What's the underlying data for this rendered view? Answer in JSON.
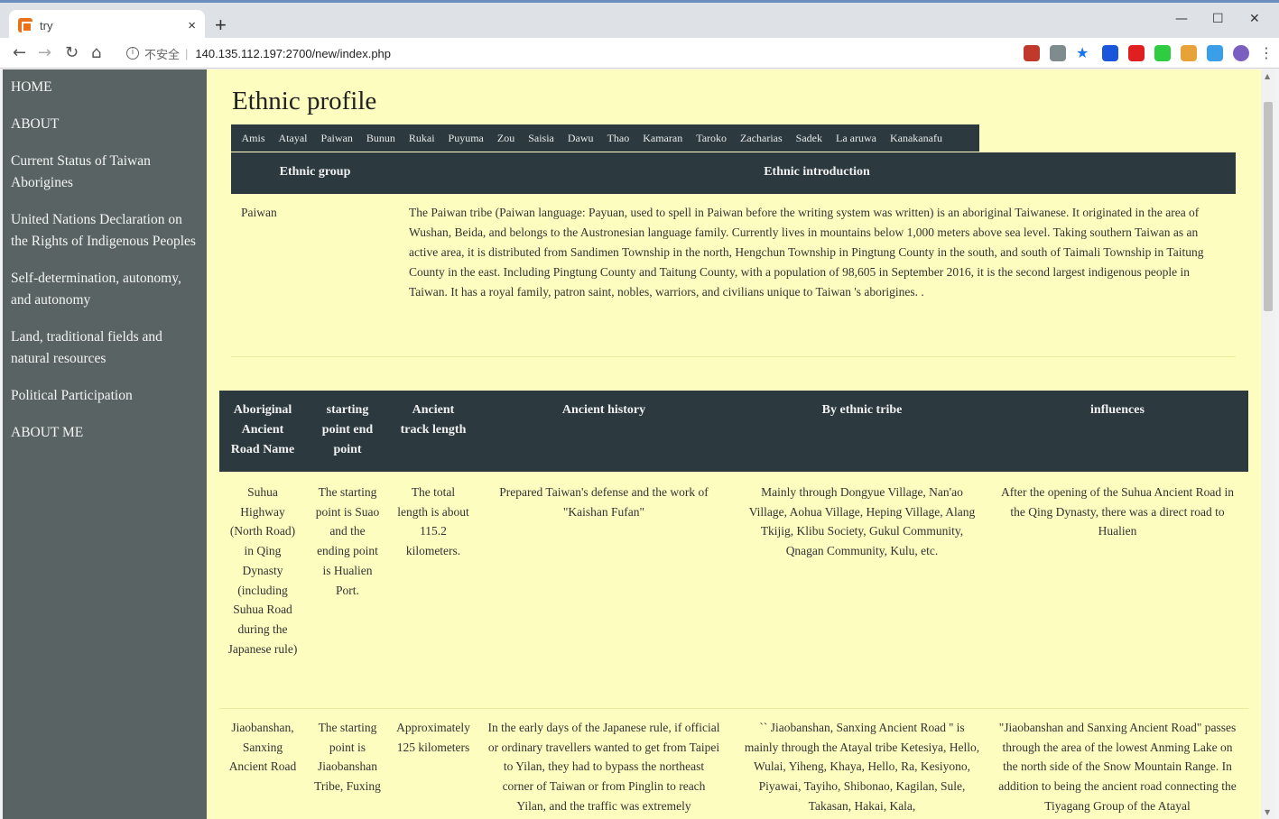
{
  "browser": {
    "tab_title": "try",
    "tab_close": "×",
    "new_tab": "+",
    "security_label": "不安全",
    "url": "140.135.112.197:2700/new/index.php",
    "window_controls": [
      "—",
      "☐",
      "✕"
    ],
    "nav": {
      "back": "←",
      "forward": "→",
      "reload": "↻",
      "home": "⌂"
    },
    "extensions": [
      {
        "name": "ext-icon-1",
        "color": "#c0392b"
      },
      {
        "name": "ext-icon-2",
        "color": "#7f8c8d"
      },
      {
        "name": "bookmark-star-icon",
        "color": "#1a73e8"
      },
      {
        "name": "ext-icon-3",
        "color": "#1a56db"
      },
      {
        "name": "ext-icon-4",
        "color": "#e02020"
      },
      {
        "name": "ext-icon-5",
        "color": "#2ecc40"
      },
      {
        "name": "ext-icon-6",
        "color": "#e8a23a"
      },
      {
        "name": "ext-icon-7",
        "color": "#3b9ee8"
      },
      {
        "name": "profile-avatar-icon",
        "color": "#7a5fc0"
      },
      {
        "name": "menu-icon",
        "color": "#555555"
      }
    ]
  },
  "sidebar": {
    "items": [
      {
        "label": "HOME"
      },
      {
        "label": "ABOUT"
      },
      {
        "label": "Current Status of Taiwan Aborigines"
      },
      {
        "label": "United Nations Declaration on the Rights of Indigenous Peoples"
      },
      {
        "label": "Self-determination, autonomy, and autonomy"
      },
      {
        "label": "Land, traditional fields and natural resources"
      },
      {
        "label": "Political Participation"
      },
      {
        "label": "ABOUT ME"
      }
    ]
  },
  "main": {
    "title": "Ethnic profile",
    "tribe_tabs": [
      "Amis",
      "Atayal",
      "Paiwan",
      "Bunun",
      "Rukai",
      "Puyuma",
      "Zou",
      "Saisia",
      "Dawu",
      "Thao",
      "Kamaran",
      "Taroko",
      "Zacharias",
      "Sadek",
      "La aruwa",
      "Kanakanafu"
    ],
    "profile_table": {
      "headers": {
        "group": "Ethnic group",
        "intro": "Ethnic introduction"
      },
      "row": {
        "group": "Paiwan",
        "intro": "The Paiwan tribe (Paiwan language: Payuan, used to spell in Paiwan before the writing system was written) is an aboriginal Taiwanese. It originated in the area of Wushan, Beida, and belongs to the Austronesian language family. Currently lives in mountains below 1,000 meters above sea level. Taking southern Taiwan as an active area, it is distributed from Sandimen Township in the north, Hengchun Township in Pingtung County in the south, and south of Taimali Township in Taitung County in the east. Including Pingtung County and Taitung County, with a population of 98,605 in September 2016, it is the second largest indigenous people in Taiwan. It has a royal family, patron saint, nobles, warriors, and civilians unique to Taiwan 's aborigines. ."
      }
    },
    "road_table": {
      "headers": {
        "name": "Aboriginal Ancient Road Name",
        "points": "starting point end point",
        "length": "Ancient track length",
        "history": "Ancient history",
        "tribe": "By ethnic tribe",
        "influences": "influences"
      },
      "rows": [
        {
          "name": "Suhua Highway (North Road) in Qing Dynasty (including Suhua Road during the Japanese rule)",
          "points": "The starting point is Suao and the ending point is Hualien Port.",
          "length": "The total length is about 115.2 kilometers.",
          "history": "Prepared Taiwan's defense and the work of \"Kaishan Fufan\"",
          "tribe": "Mainly through Dongyue Village, Nan'ao Village, Aohua Village, Heping Village, Alang Tkijig, Klibu Society, Gukul Community, Qnagan Community, Kulu, etc.",
          "influences": "After the opening of the Suhua Ancient Road in the Qing Dynasty, there was a direct road to Hualien"
        },
        {
          "name": "Jiaobanshan, Sanxing Ancient Road",
          "points": "The starting point is Jiaobanshan Tribe, Fuxing",
          "length": "Approximately 125 kilometers",
          "history": "In the early days of the Japanese rule, if official or ordinary travellers wanted to get from Taipei to Yilan, they had to bypass the northeast corner of Taiwan or from Pinglin to reach Yilan, and the traffic was extremely",
          "tribe": "`` Jiaobanshan, Sanxing Ancient Road '' is mainly through the Atayal tribe Ketesiya, Hello, Wulai, Yiheng, Khaya, Hello, Ra, Kesiyono, Piyawai, Tayiho, Shibonao, Kagilan, Sule, Takasan, Hakai, Kala,",
          "influences": "\"Jiaobanshan and Sanxing Ancient Road\" passes through the area of the lowest Anming Lake on the north side of the Snow Mountain Range. In addition to being the ancient road connecting the Tiyagang Group of the Atayal"
        }
      ]
    }
  }
}
